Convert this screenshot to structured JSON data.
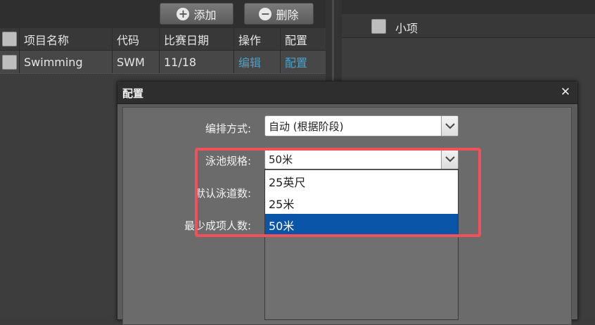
{
  "toolbar": {
    "add_label": "添加",
    "delete_label": "删除"
  },
  "table": {
    "headers": [
      "项目名称",
      "代码",
      "比赛日期",
      "操作",
      "配置"
    ],
    "rows": [
      {
        "name": "Swimming",
        "code": "SWM",
        "date": "11/18",
        "action": "编辑",
        "config": "配置"
      }
    ]
  },
  "right_panel": {
    "header": "小项"
  },
  "dialog": {
    "title": "配置",
    "close_glyph": "✕",
    "fields": {
      "schedule_mode_label": "编排方式:",
      "schedule_mode_value": "自动 (根据阶段)",
      "pool_size_label": "泳池规格:",
      "pool_size_value": "50米",
      "lanes_label": "默认泳道数:",
      "min_team_label": "最少成项人数:"
    },
    "pool_options": [
      "25英尺",
      "25米",
      "50米"
    ],
    "pool_selected": "50米"
  },
  "colors": {
    "accent_link": "#4ba0c8",
    "selected_option": "#0a55a8",
    "highlight_box": "#f2505a"
  },
  "icons": {
    "add": "plus-circle-icon",
    "delete": "minus-circle-icon",
    "close": "close-icon",
    "select_arrow": "chevron-down-icon"
  }
}
